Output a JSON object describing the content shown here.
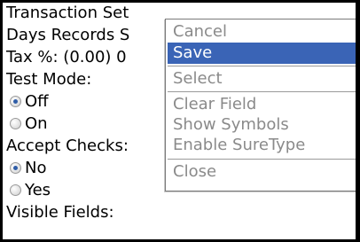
{
  "form": {
    "title": "Transaction Set",
    "days_records": "Days Records S",
    "tax_label": "Tax %: (0.00) 0",
    "test_mode_label": "Test Mode:",
    "test_mode_options": [
      "Off",
      "On"
    ],
    "test_mode_selected": "Off",
    "accept_checks_label": "Accept Checks:",
    "accept_checks_options": [
      "No",
      "Yes"
    ],
    "accept_checks_selected": "No",
    "visible_fields_label": "Visible Fields:"
  },
  "menu": {
    "items": [
      "Cancel",
      "Save",
      "Select",
      "Clear Field",
      "Show Symbols",
      "Enable SureType",
      "Close"
    ],
    "highlighted": "Save"
  },
  "colors": {
    "highlight": "#3a64b6",
    "menu_text": "#8a8a8a",
    "radio_dot": "#2f5da7"
  }
}
